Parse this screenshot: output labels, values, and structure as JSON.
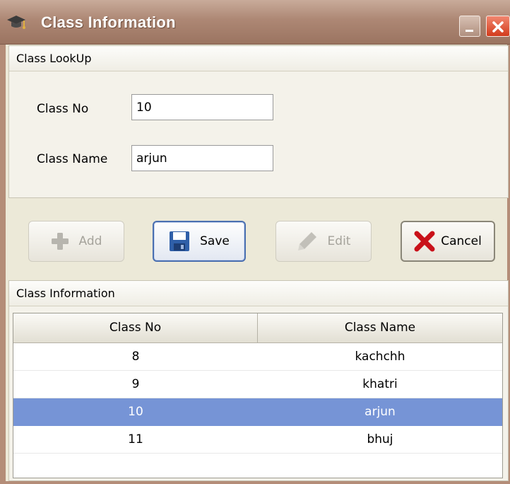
{
  "window": {
    "title": "Class Information",
    "icon": "graduation-cap-icon",
    "controls": [
      "minimize-icon",
      "close-icon"
    ]
  },
  "lookup": {
    "header": "Class LookUp",
    "class_no_label": "Class No",
    "class_no_value": "10",
    "class_name_label": "Class Name",
    "class_name_value": "arjun"
  },
  "toolbar": {
    "add": {
      "label": "Add",
      "icon": "plus-icon",
      "enabled": false
    },
    "save": {
      "label": "Save",
      "icon": "floppy-disk-icon",
      "enabled": true,
      "focused": true
    },
    "edit": {
      "label": "Edit",
      "icon": "pencil-icon",
      "enabled": false
    },
    "cancel": {
      "label": "Cancel",
      "icon": "red-x-icon",
      "enabled": true
    }
  },
  "info": {
    "header": "Class Information",
    "columns": [
      "Class No",
      "Class Name"
    ],
    "rows": [
      {
        "class_no": "8",
        "class_name": "kachchh"
      },
      {
        "class_no": "9",
        "class_name": "khatri"
      },
      {
        "class_no": "10",
        "class_name": "arjun",
        "selected": true
      },
      {
        "class_no": "11",
        "class_name": "bhuj"
      }
    ]
  },
  "colors": {
    "titlebar": "#ad8774",
    "selection": "#7694d6",
    "close_button": "#d23b1b"
  }
}
